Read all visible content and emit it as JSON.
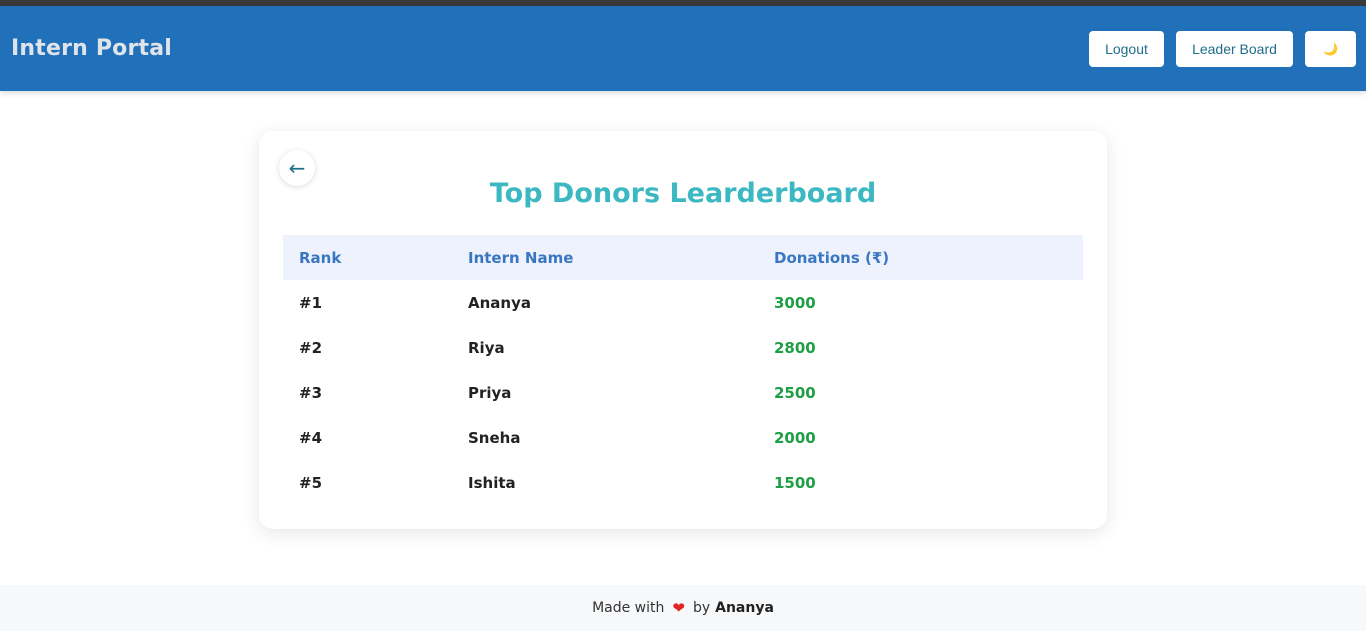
{
  "navbar": {
    "brand": "Intern Portal",
    "logout_label": "Logout",
    "leaderboard_label": "Leader Board",
    "theme_toggle_icon": "moon-icon",
    "theme_toggle_glyph": "🌙"
  },
  "card": {
    "back_glyph": "←",
    "title": "Top Donors Learderboard",
    "columns": [
      "Rank",
      "Intern Name",
      "Donations (₹)"
    ],
    "rows": [
      {
        "rank": "#1",
        "name": "Ananya",
        "donation": "3000"
      },
      {
        "rank": "#2",
        "name": "Riya",
        "donation": "2800"
      },
      {
        "rank": "#3",
        "name": "Priya",
        "donation": "2500"
      },
      {
        "rank": "#4",
        "name": "Sneha",
        "donation": "2000"
      },
      {
        "rank": "#5",
        "name": "Ishita",
        "donation": "1500"
      }
    ]
  },
  "footer": {
    "made_with": "Made with",
    "heart_glyph": "❤",
    "by": "by",
    "author": "Ananya"
  },
  "colors": {
    "navbar_bg": "#2170ba",
    "title": "#3bb8c2",
    "header_text": "#3a77c2",
    "amount": "#1e9e45"
  }
}
